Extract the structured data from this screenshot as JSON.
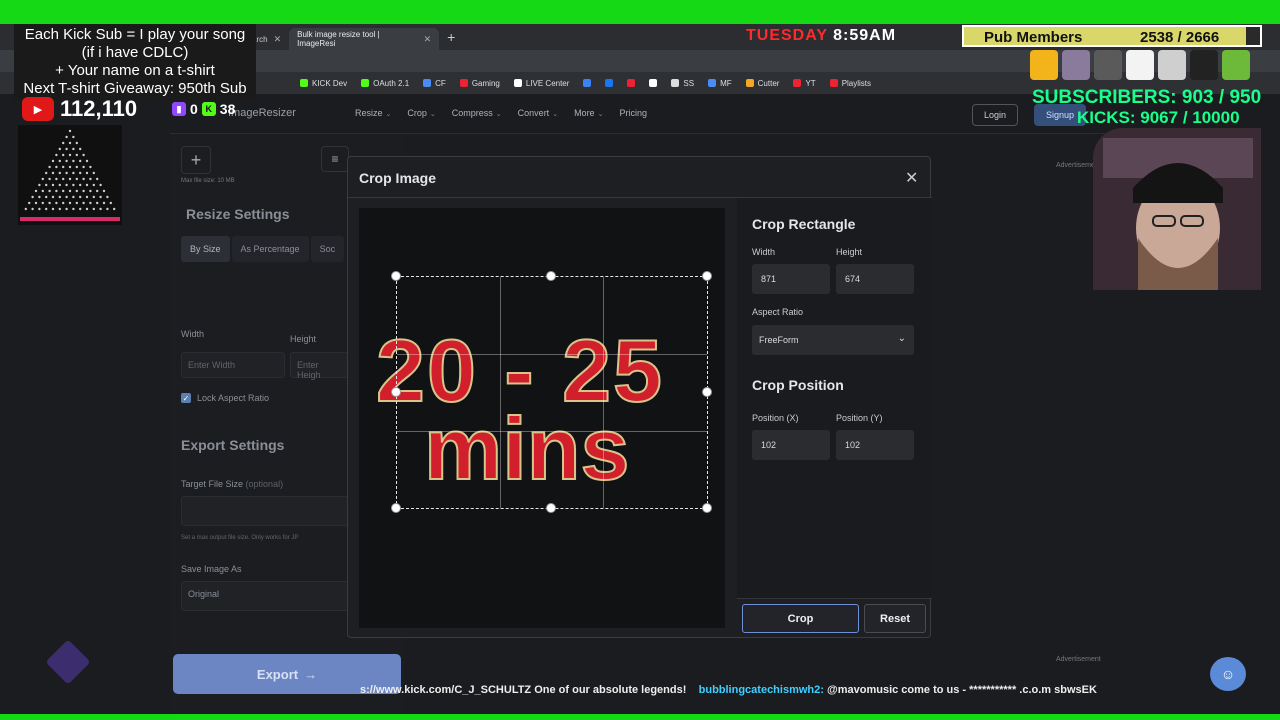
{
  "browser": {
    "tabs": [
      {
        "label": "arch"
      },
      {
        "label": "Bulk image resize tool | ImageResi"
      }
    ],
    "address": "https://imageresizer.com/resize/editor",
    "bookmarks": [
      {
        "label": "KICK Dev",
        "color": "#53fc18"
      },
      {
        "label": "OAuth 2.1",
        "color": "#53fc18"
      },
      {
        "label": "CF",
        "color": "#4a8cf7"
      },
      {
        "label": "Gaming",
        "color": "#e23"
      },
      {
        "label": "LIVE Center",
        "color": "#fff"
      },
      {
        "label": "",
        "color": "#3b82f6"
      },
      {
        "label": "",
        "color": "#1877f2"
      },
      {
        "label": "",
        "color": "#e23"
      },
      {
        "label": "",
        "color": "#fff"
      },
      {
        "label": "SS",
        "color": "#ddd"
      },
      {
        "label": "MF",
        "color": "#4a8cf7"
      },
      {
        "label": "Cutter",
        "color": "#f5a623"
      },
      {
        "label": "YT",
        "color": "#e23"
      },
      {
        "label": "Playlists",
        "color": "#e23"
      }
    ]
  },
  "site": {
    "brand": "ImageResizer",
    "nav": [
      "Resize",
      "Crop",
      "Compress",
      "Convert",
      "More",
      "Pricing"
    ],
    "login": "Login",
    "signup": "Signup",
    "ad_label": "Advertisement"
  },
  "left_panel": {
    "max_file": "Max file size: 10 MB",
    "resize_title": "Resize Settings",
    "tabs": [
      "By Size",
      "As Percentage",
      "Soc"
    ],
    "width_label": "Width",
    "height_label": "Height",
    "width_placeholder": "Enter Width",
    "height_placeholder": "Enter Heigh",
    "lock_label": "Lock Aspect Ratio",
    "export_title": "Export Settings",
    "target_label": "Target File Size",
    "target_optional": "(optional)",
    "target_hint": "Set a max output file size. Only works for JP",
    "save_as_label": "Save Image As",
    "save_as_value": "Original",
    "export_button": "Export",
    "export_arrow": "→"
  },
  "modal": {
    "title": "Crop Image",
    "close": "✕",
    "image_line1": "20 - 25",
    "image_line2": "mins",
    "crop_rect_title": "Crop Rectangle",
    "width_label": "Width",
    "height_label": "Height",
    "width_value": "871",
    "height_value": "674",
    "aspect_label": "Aspect Ratio",
    "aspect_value": "FreeForm",
    "crop_pos_title": "Crop Position",
    "pos_x_label": "Position (X)",
    "pos_y_label": "Position (Y)",
    "pos_x_value": "102",
    "pos_y_value": "102",
    "crop_button": "Crop",
    "reset_button": "Reset"
  },
  "overlay": {
    "sub_line1": "Each Kick Sub = I play your song",
    "sub_line2": "(if i have CDLC)",
    "sub_line3": "+ Your name on a t-shirt",
    "sub_line4": "Next T-shirt Giveaway: 950th Sub",
    "youtube_count": "112,110",
    "twitch_count": "0",
    "kick_count": "38",
    "clock_day": "TUESDAY",
    "clock_time": "8:59AM",
    "pub_label": "Pub Members",
    "pub_count": "2538 / 2666",
    "pub_progress": 0.952,
    "subscribers": "SUBSCRIBERS: 903 / 950",
    "kicks": "KICKS: 9067 / 10000",
    "ticker_url": "s://www.kick.com/C_J_SCHULTZ One of our absolute legends!",
    "ticker_user": "bubblingcatechismwh2:",
    "ticker_msg": "@mavomusic come to us - *********** .c.o.m sbwsEK"
  }
}
